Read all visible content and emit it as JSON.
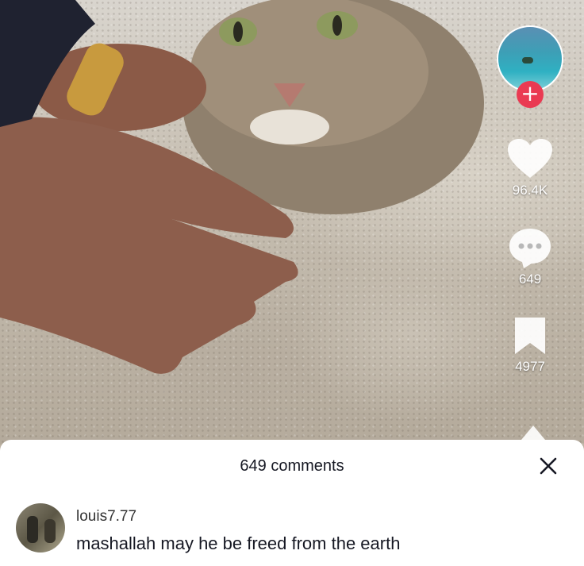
{
  "actions": {
    "likes": "96.4K",
    "comments": "649",
    "saves": "4977",
    "follow_symbol": "+"
  },
  "sheet": {
    "title": "649 comments",
    "close_symbol": "✕"
  },
  "comments": [
    {
      "username": "louis7.77",
      "text": "mashallah may he be freed from the earth"
    }
  ],
  "colors": {
    "follow_plus": "#ea3a52",
    "sheet_bg": "#ffffff",
    "text_primary": "#161823"
  }
}
